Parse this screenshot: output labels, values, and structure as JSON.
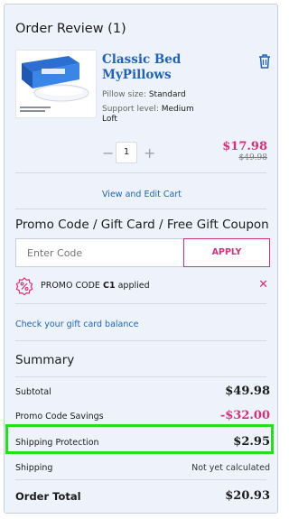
{
  "order": {
    "title": "Order Review (1)",
    "item": {
      "name": "Classic Bed MyPillows",
      "size_label": "Pillow size:",
      "size_value": "Standard",
      "support_label": "Support level:",
      "support_value": "Medium Loft",
      "quantity": "1",
      "price": "$17.98",
      "original_price": "$49.98",
      "qty_minus": "−",
      "qty_plus": "+",
      "icon": "trash-icon"
    },
    "view_edit_link": "View and Edit Cart"
  },
  "promo": {
    "title": "Promo Code / Gift Card / Free Gift Coupon",
    "input_placeholder": "Enter Code",
    "apply_label": "APPLY",
    "applied_prefix": "PROMO CODE",
    "applied_code": "C1",
    "applied_suffix": "applied",
    "remove_glyph": "✕",
    "gift_card_link": "Check your gift card balance"
  },
  "summary": {
    "title": "Summary",
    "subtotal_label": "Subtotal",
    "subtotal_value": "$49.98",
    "savings_label": "Promo Code Savings",
    "savings_value": "-$32.00",
    "protection_label": "Shipping Protection",
    "protection_value": "$2.95",
    "shipping_label": "Shipping",
    "shipping_value": "Not yet calculated",
    "total_label": "Order Total",
    "total_value": "$20.93"
  },
  "colors": {
    "accent_pink": "#d6307a",
    "link_blue": "#1f63b8",
    "highlight_green": "#22e01a",
    "panel_bg": "#eef3fb"
  }
}
